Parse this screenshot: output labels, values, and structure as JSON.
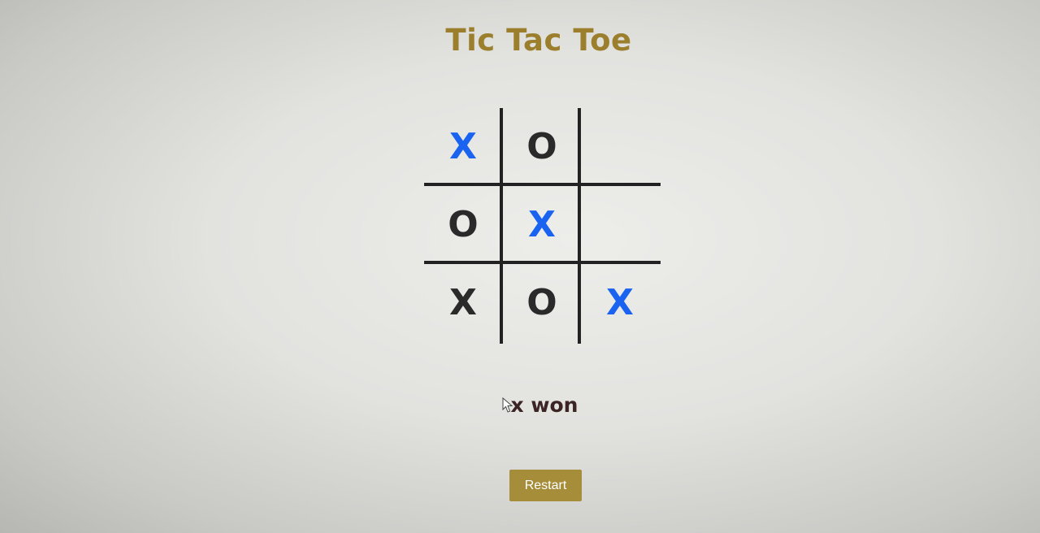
{
  "page": {
    "title": "Tic Tac Toe"
  },
  "board": {
    "cells": [
      {
        "mark": "X",
        "highlight": true
      },
      {
        "mark": "O",
        "highlight": false
      },
      {
        "mark": "",
        "highlight": false
      },
      {
        "mark": "O",
        "highlight": false
      },
      {
        "mark": "X",
        "highlight": true
      },
      {
        "mark": "",
        "highlight": false
      },
      {
        "mark": "X",
        "highlight": false
      },
      {
        "mark": "O",
        "highlight": false
      },
      {
        "mark": "X",
        "highlight": true
      }
    ]
  },
  "status": {
    "text": "x won"
  },
  "controls": {
    "restart_label": "Restart"
  },
  "colors": {
    "title": "#9c7f2c",
    "winning_mark": "#1a63f0",
    "mark": "#2a2a2a",
    "restart_button": "#a58d3a",
    "status_text": "#3c2424"
  }
}
